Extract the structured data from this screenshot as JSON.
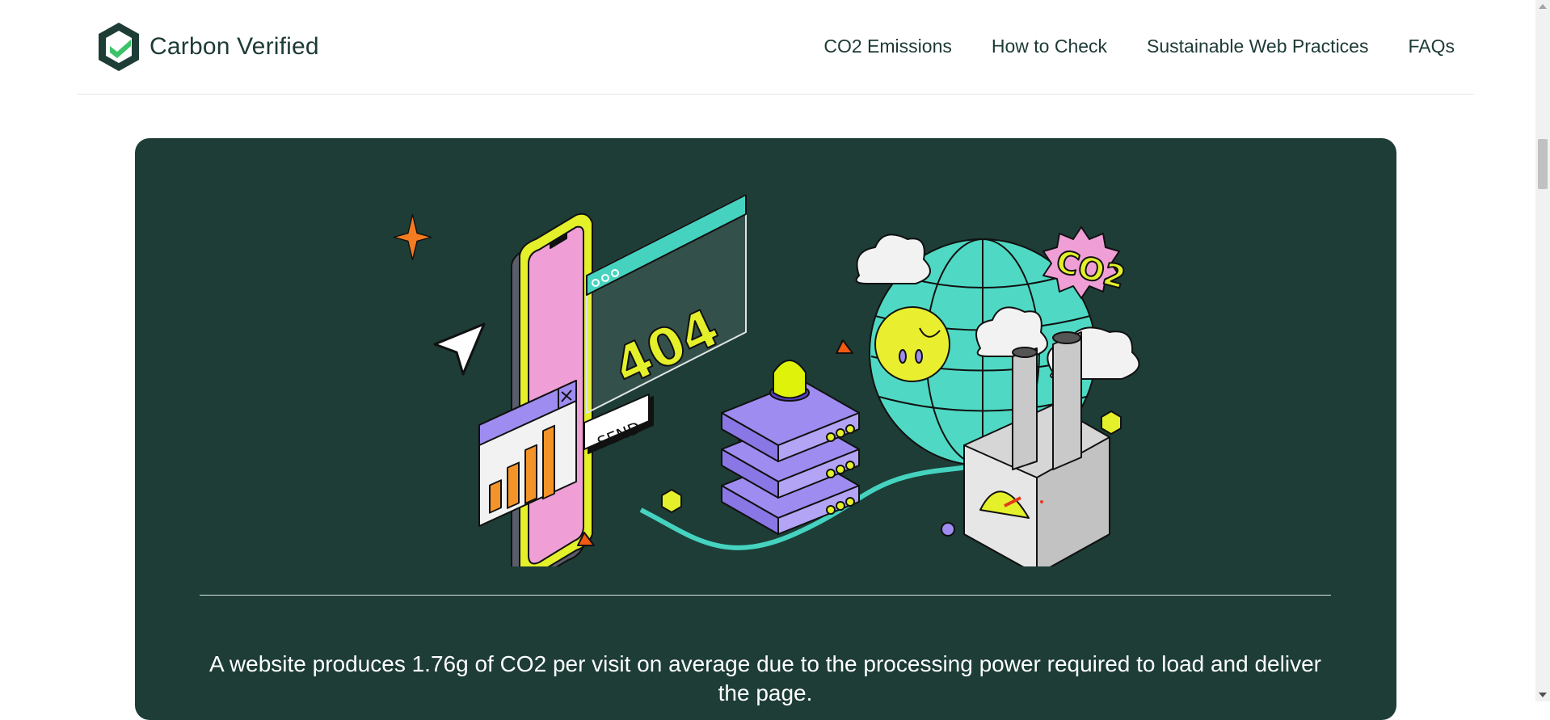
{
  "brand": {
    "name": "Carbon Verified",
    "logo_icon": "hexagon-check-icon",
    "colors": {
      "dark_green": "#1d3d36",
      "accent_green": "#3cc36a"
    }
  },
  "nav": {
    "items": [
      {
        "label": "CO2 Emissions"
      },
      {
        "label": "How to Check"
      },
      {
        "label": "Sustainable Web Practices"
      },
      {
        "label": "FAQs"
      }
    ]
  },
  "hero": {
    "illustration": {
      "screen_text": "404",
      "button_text": "SEND",
      "badge_text": "CO2"
    },
    "caption": "A website produces 1.76g of CO2 per visit on average due to the processing power required to load and deliver the page."
  }
}
